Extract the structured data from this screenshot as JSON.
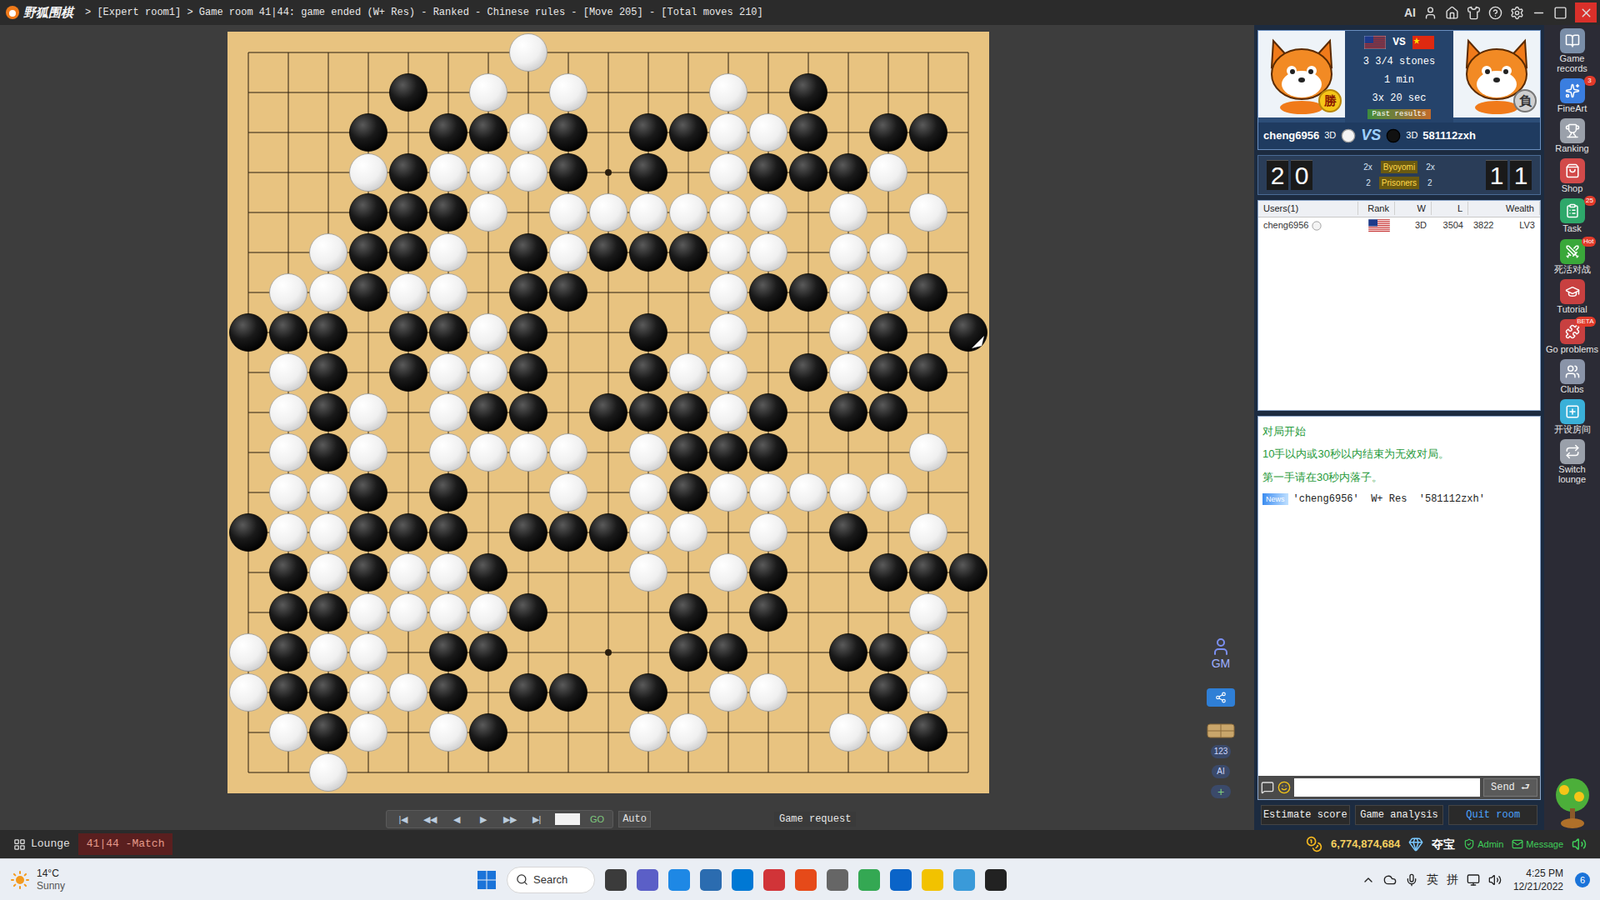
{
  "window": {
    "logo": "野狐围棋",
    "title": "> [Expert room1] > Game room 41|44: game ended (W+ Res) - Ranked - Chinese rules - [Move 205] - [Total moves 210]",
    "ai_button": "AI"
  },
  "board": {
    "rows": [
      ".......W...........",
      "....B.W.W...W.B....",
      "...B.BBWB.BBWWB.BB.",
      "...WBWWWB.B.WBBBW..",
      "...BBBW.WWWWWW.W.W.",
      "..WBBW.BWBBBWW.WW..",
      ".WWBWW.BB...WBBWWB.",
      "BBB.BBWB..B.W..WB.B",
      ".WB.BWWB..BWW.BWBB.",
      ".WBW.WBB.BBBWB.BB..",
      ".WBW.WWWW.WBBB...W.",
      ".WWB.B..W.WBWWWWW..",
      "BWWBBB.BBBWW.W.B.W.",
      ".BWBWWB...W.WB..BBB",
      ".BBWWWWB...B.B...W.",
      "WBWW.BB....BB..BBW.",
      "WBBWWB.BB.B.WW..BW.",
      ".WBW.WB...WW...WWB.",
      "..W................"
    ],
    "last_move": {
      "row": 7,
      "col": 18
    }
  },
  "replay_controls": {
    "buttons": [
      "|◀",
      "◀◀",
      "◀",
      "▶",
      "▶▶",
      "▶|"
    ],
    "go": "GO",
    "auto": "Auto",
    "game_request": "Game request"
  },
  "side_tools": {
    "gm": "GM",
    "counter": "123",
    "ai": "AI",
    "add": "+"
  },
  "match": {
    "komi": "3 3/4 stones",
    "main_time": "1 min",
    "byoyomi": "3x 20 sec",
    "past_results": "Past results",
    "vs": "VS",
    "white": {
      "name": "cheng6956",
      "rank": "3D",
      "country": "US",
      "badge": "勝",
      "winner": true
    },
    "black": {
      "name": "581112zxh",
      "rank": "3D",
      "country": "CN",
      "badge": "負",
      "winner": false
    }
  },
  "clock": {
    "white_digits": [
      "2",
      "0"
    ],
    "black_digits": [
      "1",
      "1"
    ],
    "byoyomi": {
      "label": "Byoyomi",
      "white": "2x",
      "black": "2x"
    },
    "prisoners": {
      "label": "Prisoners",
      "white": "2",
      "black": "2"
    }
  },
  "users": {
    "columns": [
      "Users(1)",
      "Rank",
      "W",
      "L",
      "Wealth"
    ],
    "rows": [
      {
        "name": "cheng6956",
        "stone": "white",
        "country": "US",
        "rank": "3D",
        "wins": "3504",
        "losses": "3822",
        "wealth": "LV3",
        "selected": false
      }
    ]
  },
  "chat": {
    "messages": [
      {
        "kind": "system",
        "text": "对局开始"
      },
      {
        "kind": "system",
        "text": "10手以内或30秒以内结束为无效对局。"
      },
      {
        "kind": "system",
        "text": "第一手请在30秒内落子。"
      },
      {
        "kind": "news",
        "tag": "News",
        "text": "'cheng6956'  W+ Res  '581112zxh'"
      }
    ],
    "send": "Send"
  },
  "panel_buttons": [
    {
      "label": "Estimate score",
      "kind": "normal"
    },
    {
      "label": "Game analysis",
      "kind": "normal"
    },
    {
      "label": "Quit room",
      "kind": "exit"
    }
  ],
  "sidebar": [
    {
      "label": "Game records"
    },
    {
      "label": "FineArt",
      "badge": "3"
    },
    {
      "label": "Ranking"
    },
    {
      "label": "Shop"
    },
    {
      "label": "Task",
      "badge": "25"
    },
    {
      "label": "死活对战",
      "badge": "Hot"
    },
    {
      "label": "Tutorial"
    },
    {
      "label": "Go problems",
      "badge": "BETA"
    },
    {
      "label": "Clubs"
    },
    {
      "label": "开设房间"
    },
    {
      "label": "Switch lounge"
    }
  ],
  "bottom_tabs": [
    {
      "label": "Lounge",
      "selected": false
    },
    {
      "label": "41|44 -Match",
      "selected": true
    }
  ],
  "status": {
    "coins": "6,774,874,684",
    "treasure": "夺宝",
    "admin": "Admin",
    "message": "Message"
  },
  "taskbar": {
    "temperature": "14°C",
    "weather": "Sunny",
    "search": "Search",
    "input_methods": [
      "英",
      "拼"
    ],
    "time": "4:25 PM",
    "date": "12/21/2022",
    "notifications": "6"
  }
}
